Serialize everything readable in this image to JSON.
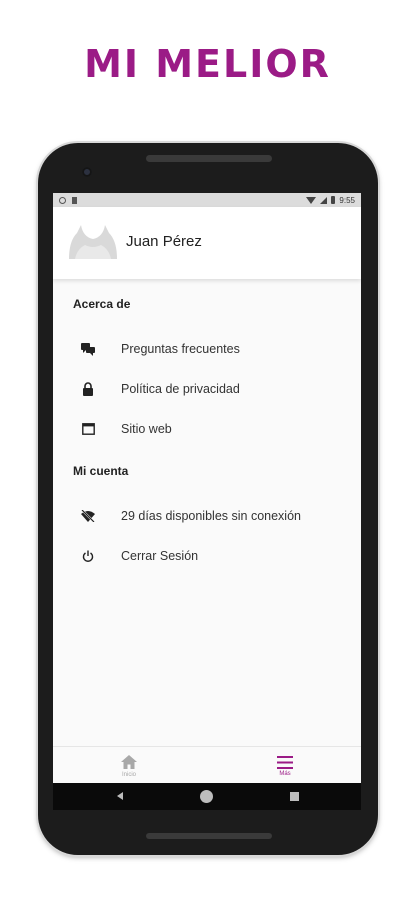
{
  "headline": "MI MELIOR",
  "status_bar": {
    "time": "9:55"
  },
  "profile": {
    "name": "Juan Pérez"
  },
  "sections": [
    {
      "title": "Acerca de",
      "items": [
        {
          "icon": "forum-icon",
          "label": "Preguntas frecuentes"
        },
        {
          "icon": "lock-icon",
          "label": "Política de privacidad"
        },
        {
          "icon": "web-window-icon",
          "label": "Sitio web"
        }
      ]
    },
    {
      "title": "Mi cuenta",
      "items": [
        {
          "icon": "wifi-off-icon",
          "label": "29 días disponibles sin conexión"
        },
        {
          "icon": "power-icon",
          "label": "Cerrar Sesión"
        }
      ]
    }
  ],
  "bottom_nav": [
    {
      "icon": "home-icon",
      "label": "Inicio",
      "active": false
    },
    {
      "icon": "menu-icon",
      "label": "Más",
      "active": true
    }
  ],
  "colors": {
    "brand": "#9b1b86",
    "nav_inactive": "#a8a8a8",
    "nav_active": "#9b1b86"
  }
}
